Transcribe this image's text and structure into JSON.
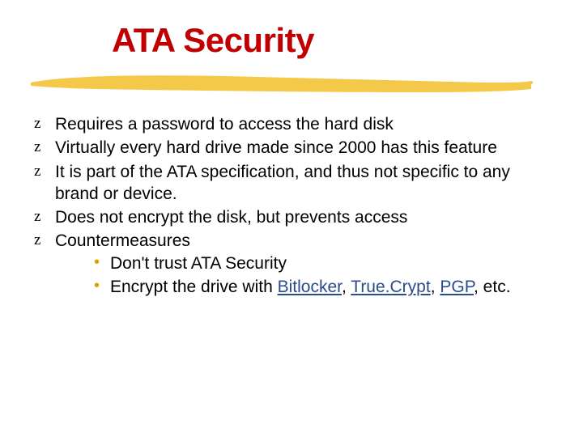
{
  "title": "ATA Security",
  "bullets": {
    "b0": "Requires a password to access the hard disk",
    "b1": "Virtually every hard drive made since 2000 has this feature",
    "b2": "It is part of the ATA specification, and thus not specific to any brand or device.",
    "b3": "Does not encrypt the disk, but prevents access",
    "b4": "Countermeasures",
    "sub0": "Don't trust ATA Security",
    "sub1_prefix": "Encrypt the drive with ",
    "sub1_suffix": ", etc."
  },
  "links": {
    "l0": "Bitlocker",
    "l1": "True.Crypt",
    "l2": "PGP"
  },
  "sep": ", "
}
